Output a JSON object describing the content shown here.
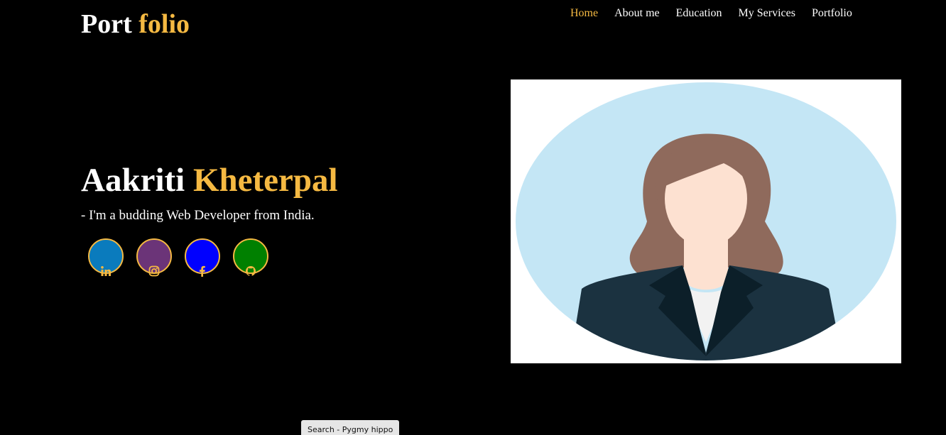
{
  "header": {
    "logo_part1": "Port",
    "logo_part2": "folio",
    "nav": [
      {
        "label": "Home",
        "active": true
      },
      {
        "label": "About me"
      },
      {
        "label": "Education"
      },
      {
        "label": "My Services"
      },
      {
        "label": "Portfolio"
      }
    ]
  },
  "hero": {
    "first_name": "Aakriti",
    "last_name": "Kheterpal",
    "tagline": "- I'm a budding Web Developer from India."
  },
  "socials": [
    {
      "icon": "linkedin-icon",
      "color": "#0a7bbd"
    },
    {
      "icon": "instagram-icon",
      "color": "#6b3478"
    },
    {
      "icon": "facebook-icon",
      "color": "#0000ff"
    },
    {
      "icon": "github-icon",
      "color": "#008000"
    }
  ],
  "search_chip": "Search - Pygmy hippo",
  "colors": {
    "background": "#000000",
    "accent": "#f5b942",
    "text": "#ffffff"
  }
}
